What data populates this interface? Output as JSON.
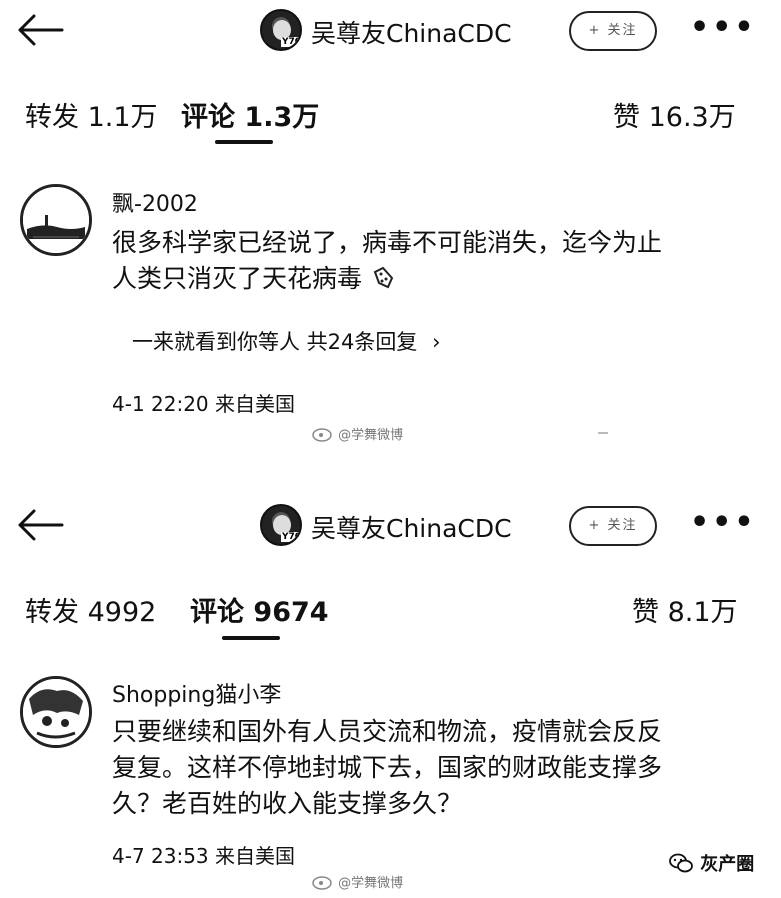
{
  "screens": [
    {
      "header": {
        "title": "吴尊友ChinaCDC",
        "follow_label": "+ 关注"
      },
      "tabs": {
        "repost_label": "转发",
        "repost_count": "1.1万",
        "comment_label": "评论",
        "comment_count": "1.3万",
        "like_label": "赞",
        "like_count": "16.3万"
      },
      "comment": {
        "user": "飘-2002",
        "lines": [
          "很多科学家已经说了，病毒不可能消失，迄今为止",
          "人类只消灭了天花病毒"
        ],
        "reply_text": "一来就看到你等人 共24条回复",
        "reply_arrow": "›",
        "time": "4-1 22:20",
        "location": "来自美国"
      }
    },
    {
      "header": {
        "title": "吴尊友ChinaCDC",
        "follow_label": "+ 关注"
      },
      "tabs": {
        "repost_label": "转发",
        "repost_count": "4992",
        "comment_label": "评论",
        "comment_count": "9674",
        "like_label": "赞",
        "like_count": "8.1万"
      },
      "comment": {
        "user": "Shopping猫小李",
        "lines": [
          "只要继续和国外有人员交流和物流，疫情就会反反",
          "复复。这样不停地封城下去，国家的财政能支撑多",
          "久？老百姓的收入能支撑多久？"
        ],
        "time": "4-7 23:53",
        "location": "来自美国"
      }
    }
  ],
  "watermark": {
    "weibo_text": "@学舞微博",
    "brand_text": "灰产圈"
  },
  "icons": {
    "back": "back-arrow-icon",
    "more": "more-dots-icon",
    "virus": "virus-icon",
    "weibo": "weibo-logo-icon",
    "wechat": "wechat-icon"
  }
}
